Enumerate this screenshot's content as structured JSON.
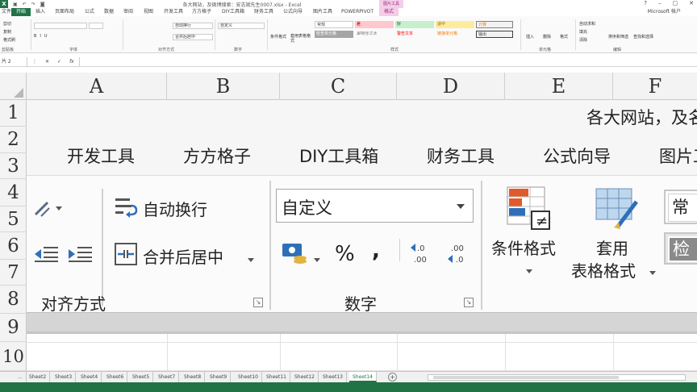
{
  "window": {
    "title": "各大网站，及微博搜索：安志斌先生0007.xlsx - Excel",
    "context_tab_group": "图片工具",
    "account": "Microsoft 帐户"
  },
  "tabs": [
    {
      "label": "文件"
    },
    {
      "label": "开始",
      "active": true
    },
    {
      "label": "插入"
    },
    {
      "label": "页面布局"
    },
    {
      "label": "公式"
    },
    {
      "label": "数据"
    },
    {
      "label": "审阅"
    },
    {
      "label": "视图"
    },
    {
      "label": "开发工具"
    },
    {
      "label": "方方格子"
    },
    {
      "label": "DIY工具箱"
    },
    {
      "label": "财务工具"
    },
    {
      "label": "公式向导"
    },
    {
      "label": "图片工具"
    },
    {
      "label": "POWERPIVOT"
    },
    {
      "label": "格式",
      "context": true
    }
  ],
  "mini_ribbon": {
    "clipboard": {
      "cut": "剪切",
      "copy": "复制",
      "format_painter": "格式刷",
      "label": "剪贴板"
    },
    "font": {
      "label": "字体"
    },
    "alignment": {
      "wrap": "自动换行",
      "merge": "合并后居中",
      "label": "对齐方式"
    },
    "number": {
      "format": "自定义",
      "label": "数字"
    },
    "styles": {
      "chips": [
        "常规",
        "差",
        "好",
        "适中",
        "计算",
        "检查单元格",
        "解释性文本",
        "警告文本",
        "链接单元格",
        "输出"
      ],
      "conditional": "条件格式",
      "table": "套用表格格式",
      "label": "样式"
    },
    "cells": {
      "insert": "插入",
      "delete": "删除",
      "format": "格式",
      "label": "单元格"
    },
    "editing": {
      "autosum": "自动求和",
      "fill": "填充",
      "clear": "清除",
      "sort": "排序和筛选",
      "find": "查找和选择",
      "label": "编辑"
    }
  },
  "formula_bar": {
    "name_box": "片 2",
    "fx": "fx",
    "value": ""
  },
  "columns": [
    "A",
    "B",
    "C",
    "D",
    "E",
    "F"
  ],
  "rows": [
    "1",
    "2",
    "3",
    "4",
    "5",
    "6",
    "7",
    "8",
    "9",
    "10"
  ],
  "picture": {
    "title_fragment": "各大网站，及名",
    "tabs": [
      "开发工具",
      "方方格子",
      "DIY工具箱",
      "财务工具",
      "公式向导",
      "图片工"
    ],
    "alignment": {
      "wrap": "自动换行",
      "merge": "合并后居中",
      "label": "对齐方式"
    },
    "number": {
      "format": "自定义",
      "percent": "%",
      "comma": ",",
      "label": "数字"
    },
    "styles": {
      "conditional": "条件格式",
      "table_line1": "套用",
      "table_line2": "表格格式",
      "normal": "常",
      "check": "检"
    }
  },
  "sheets": [
    "...",
    "Sheet2",
    "Sheet3",
    "Sheet4",
    "Sheet6",
    "Sheet5",
    "Sheet7",
    "Sheet8",
    "Sheet9",
    "Sheet10",
    "Sheet11",
    "Sheet12",
    "Sheet13",
    "Sheet14"
  ],
  "active_sheet": "Sheet14",
  "colors": {
    "accent": "#217346",
    "context": "#9c2c7c"
  }
}
